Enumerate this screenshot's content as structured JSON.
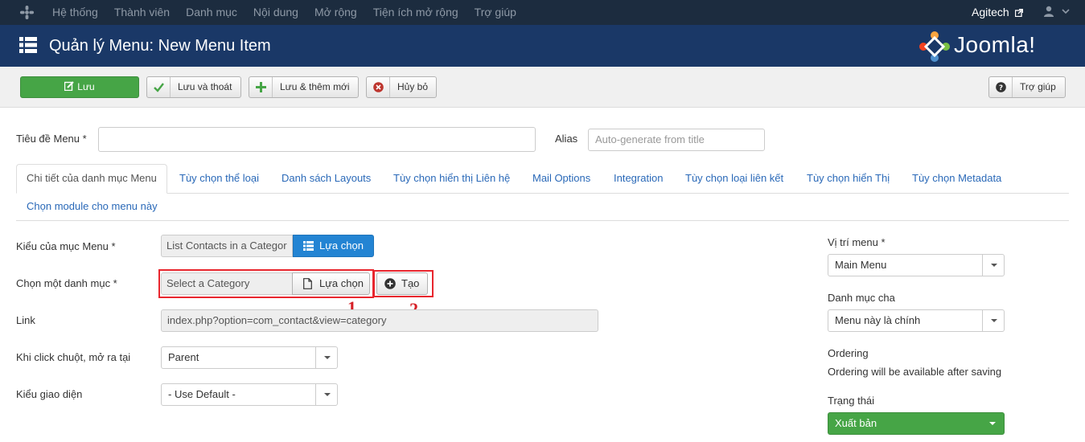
{
  "topnav": {
    "items": [
      "Hệ thống",
      "Thành viên",
      "Danh mục",
      "Nội dung",
      "Mở rộng",
      "Tiện ích mở rộng",
      "Trợ giúp"
    ],
    "site_name": "Agitech"
  },
  "titlebar": {
    "title": "Quản lý Menu: New Menu Item",
    "brand": "Joomla!"
  },
  "toolbar": {
    "save": "Lưu",
    "save_close": "Lưu và thoát",
    "save_new": "Lưu & thêm mới",
    "cancel": "Hủy bỏ",
    "help": "Trợ giúp"
  },
  "form": {
    "title_label": "Tiêu đề Menu *",
    "title_value": "",
    "alias_label": "Alias",
    "alias_placeholder": "Auto-generate from title"
  },
  "tabs": [
    "Chi tiết của danh mục Menu",
    "Tùy chọn thể loại",
    "Danh sách Layouts",
    "Tùy chọn hiển thị Liên hệ",
    "Mail Options",
    "Integration",
    "Tùy chọn loại liên kết",
    "Tùy chọn hiển Thị",
    "Tùy chọn Metadata",
    "Chọn module cho menu này"
  ],
  "details": {
    "type_label": "Kiểu của mục Menu *",
    "type_value": "List Contacts in a Categor",
    "type_button": "Lựa chọn",
    "category_label": "Chọn một danh mục *",
    "category_value": "Select a Category",
    "category_select_button": "Lựa chọn",
    "category_create_button": "Tạo",
    "link_label": "Link",
    "link_value": "index.php?option=com_contact&view=category",
    "target_label": "Khi click chuột, mở ra tại",
    "target_value": "Parent",
    "style_label": "Kiểu giao diện",
    "style_value": "- Use Default -",
    "annotation_1": "1",
    "annotation_2": "2"
  },
  "sidebar": {
    "position_label": "Vị trí menu *",
    "position_value": "Main Menu",
    "parent_label": "Danh mục cha",
    "parent_value": "Menu này là chính",
    "ordering_label": "Ordering",
    "ordering_text": "Ordering will be available after saving",
    "status_label": "Trạng thái",
    "status_value": "Xuất bản"
  },
  "colors": {
    "topnav_bg": "#1c2c3f",
    "titlebar_bg": "#1a3867",
    "save_green": "#46a546",
    "select_blue": "#2384d3",
    "annotation_red": "#e8262e"
  }
}
